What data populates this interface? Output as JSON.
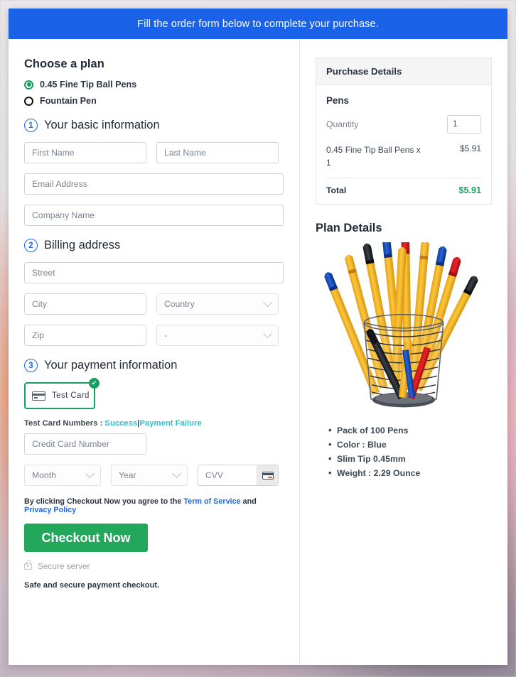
{
  "banner": {
    "text": "Fill the order form below to complete your purchase."
  },
  "plan": {
    "heading": "Choose a plan",
    "options": [
      {
        "label": "0.45 Fine Tip Ball Pens",
        "selected": true
      },
      {
        "label": "Fountain Pen",
        "selected": false
      }
    ]
  },
  "steps": {
    "basic": {
      "number": "1",
      "title": "Your basic information"
    },
    "billing": {
      "number": "2",
      "title": "Billing address"
    },
    "payment": {
      "number": "3",
      "title": "Your payment information"
    }
  },
  "fields": {
    "first_name": "First Name",
    "last_name": "Last Name",
    "email": "Email Address",
    "company": "Company Name",
    "street": "Street",
    "city": "City",
    "country": "Country",
    "zip": "Zip",
    "state": "-",
    "credit_card": "Credit Card Number",
    "month": "Month",
    "year": "Year",
    "cvv": "CVV"
  },
  "payment": {
    "card_tile_label": "Test Card",
    "card_tile_icon": "credit-card-icon",
    "selected_badge": "✔",
    "test_numbers_prefix": "Test Card Numbers :",
    "success_link": "Success",
    "separator": "|",
    "failure_link": "Payment Failure"
  },
  "terms": {
    "prefix": "By clicking Checkout Now you agree to the",
    "tos": "Term of Service",
    "and": "and",
    "privacy": "Privacy Policy"
  },
  "checkout": {
    "button_label": "Checkout Now",
    "secure_label": "Secure server",
    "secure_icon": "lock-icon",
    "safe_note": "Safe and secure payment checkout."
  },
  "purchase": {
    "header": "Purchase Details",
    "item_group": "Pens",
    "quantity_label": "Quantity",
    "quantity_value": "1",
    "line_item_desc": "0.45 Fine Tip Ball Pens x 1",
    "line_item_amount": "$5.91",
    "total_label": "Total",
    "total_amount": "$5.91"
  },
  "plan_details": {
    "heading": "Plan Details",
    "image_name": "pen-cup-photo",
    "bullets": [
      "Pack of 100 Pens",
      "Color : Blue",
      "Slim Tip 0.45mm",
      "Weight  : 2.29 Ounce"
    ]
  },
  "colors": {
    "banner_blue": "#1a63e8",
    "accent_green": "#17a05f",
    "checkout_green": "#23a75b",
    "link_blue": "#1a6ae8",
    "link_teal": "#2fc0c8",
    "step_blue": "#1a6ae8"
  }
}
